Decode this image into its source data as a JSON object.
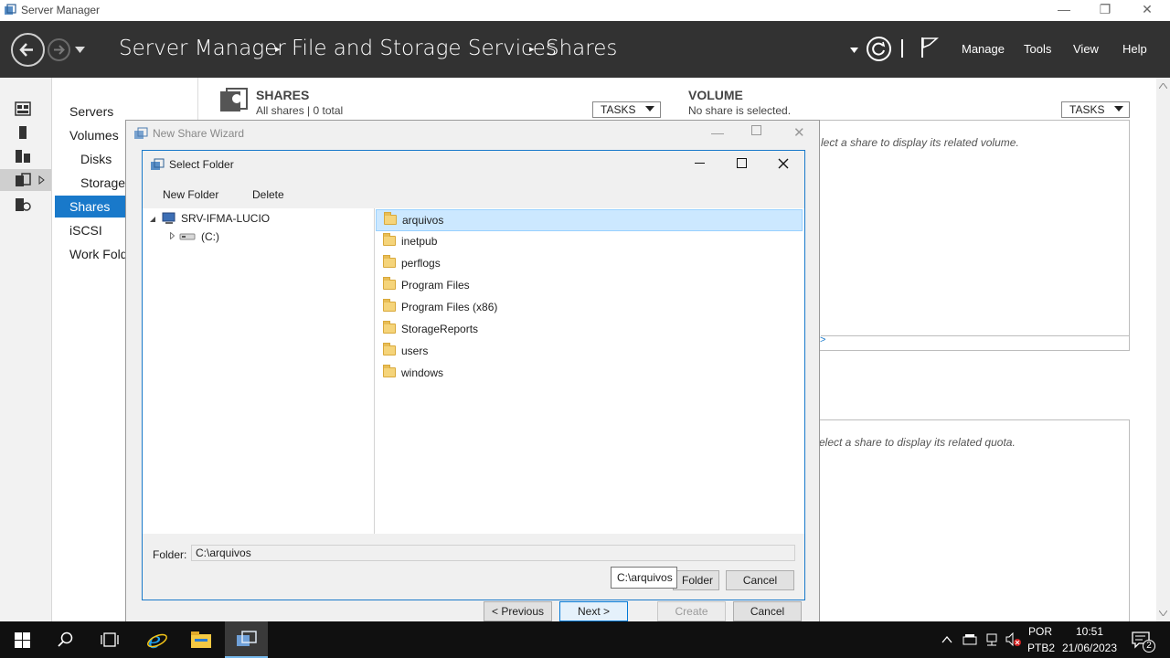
{
  "window": {
    "title": "Server Manager",
    "controls": {
      "minimize": "—",
      "restore": "❐",
      "close": "✕"
    }
  },
  "header": {
    "breadcrumb": [
      "Server Manager",
      "File and Storage Services",
      "Shares"
    ],
    "separator": "▸",
    "menu": [
      "Manage",
      "Tools",
      "View",
      "Help"
    ],
    "back_icon": "arrow-left-icon",
    "forward_icon": "arrow-right-icon",
    "refresh_icon": "refresh-icon",
    "flag_icon": "flag-icon"
  },
  "nav": {
    "items": [
      {
        "label": "Servers"
      },
      {
        "label": "Volumes"
      },
      {
        "label": "Disks"
      },
      {
        "label": "Storage"
      },
      {
        "label": "Shares"
      },
      {
        "label": "iSCSI"
      },
      {
        "label": "Work Fold"
      }
    ]
  },
  "shares_panel": {
    "title": "SHARES",
    "subtitle": "All shares | 0 total",
    "tasks_label": "TASKS"
  },
  "volume_panel": {
    "title": "VOLUME",
    "subtitle": "No share is selected.",
    "tasks_label": "TASKS",
    "hint": "lect a share to display its related volume.",
    "link_fragment": ">"
  },
  "quota_panel": {
    "hint": "elect a share to display its related quota."
  },
  "wizard": {
    "title": "New Share Wizard",
    "buttons": {
      "previous": "< Previous",
      "next": "Next >",
      "create": "Create",
      "cancel": "Cancel"
    }
  },
  "dialog": {
    "title": "Select Folder",
    "toolbar": {
      "new_folder": "New Folder",
      "delete": "Delete"
    },
    "tree": {
      "computer": "SRV-IFMA-LUCIO",
      "drive": "(C:)"
    },
    "folders": [
      "arquivos",
      "inetpub",
      "perflogs",
      "Program Files",
      "Program Files (x86)",
      "StorageReports",
      "users",
      "windows"
    ],
    "selected_folder": "arquivos",
    "folder_label": "Folder:",
    "folder_value": "C:\\arquivos",
    "tooltip": "C:\\arquivos",
    "select_button_fragment": "Folder",
    "cancel_button": "Cancel"
  },
  "taskbar": {
    "lang_top": "POR",
    "lang_bottom": "PTB2",
    "time": "10:51",
    "date": "21/06/2023",
    "notification_count": "2"
  },
  "colors": {
    "header_bg": "#323232",
    "accent": "#1979ca",
    "selected_row": "#cce8ff",
    "taskbar_bg": "#101010"
  }
}
